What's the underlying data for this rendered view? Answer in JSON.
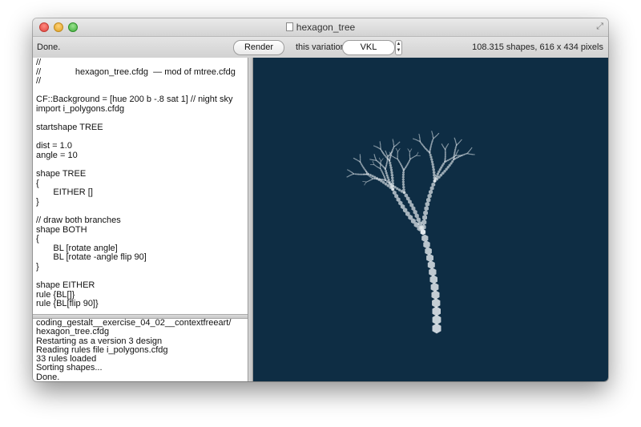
{
  "window": {
    "title": "hexagon_tree"
  },
  "toolbar": {
    "status": "Done.",
    "render_label": "Render",
    "variation_label": "this variation:",
    "variation_value": "VKL",
    "info": "108.315 shapes, 616 x 434 pixels"
  },
  "editor": {
    "lines": [
      "//",
      "//              hexagon_tree.cfdg  — mod of mtree.cfdg",
      "//",
      "",
      "CF::Background = [hue 200 b -.8 sat 1] // night sky",
      "import i_polygons.cfdg",
      "",
      "startshape TREE",
      "",
      "dist = 1.0",
      "angle = 10",
      "",
      "shape TREE",
      "{",
      "       EITHER []",
      "}",
      "",
      "// draw both branches",
      "shape BOTH",
      "{",
      "       BL [rotate angle]",
      "       BL [rotate -angle flip 90]",
      "}",
      "",
      "shape EITHER",
      "rule {BL[]}",
      "rule {BL[flip 90]}"
    ]
  },
  "console": {
    "lines": [
      "coding_gestalt__exercise_04_02__contextfreeart/",
      "hexagon_tree.cfdg",
      "Restarting as a version 3 design",
      "Reading rules file i_polygons.cfdg",
      "33 rules loaded",
      "Sorting shapes...",
      "Done."
    ]
  },
  "colors": {
    "canvas_background": "#0e2d44",
    "tree": "#e6ecf0"
  }
}
